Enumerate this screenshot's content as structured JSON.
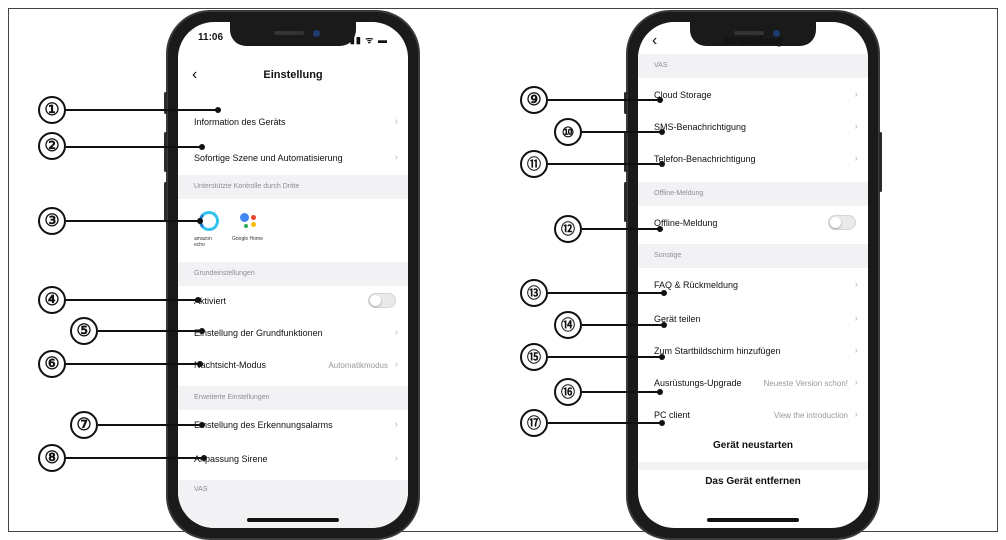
{
  "left_phone": {
    "time": "11:06",
    "status_icons": "▮▮ ᯤ ▬",
    "title": "Einstellung",
    "rows": {
      "info": "Information des Geräts",
      "szene": "Sofortige Szene und Automatisierung",
      "aktiviert": "Aktiviert",
      "grundfunktionen": "Einstellung der Grundfunktionen",
      "nachtsicht": "Nachtsicht-Modus",
      "nachtsicht_value": "Automatikmodus",
      "erkennung": "Einstellung des Erkennungsalarms",
      "sirene": "Anpassung Sirene"
    },
    "sections": {
      "dritte": "Unterstützte Kontrolle durch Dritte",
      "grund": "Grundeinstellungen",
      "erweitert": "Erweiterte Einstellungen",
      "vas": "VAS"
    },
    "logos": {
      "alexa": "amazon echo",
      "google": "Google Home"
    }
  },
  "right_phone": {
    "title": "Einstellung",
    "sections": {
      "vas": "VAS",
      "offline": "Offline-Meldung",
      "sonstige": "Sonstige"
    },
    "rows": {
      "cloud": "Cloud Storage",
      "sms": "SMS-Benachrichtigung",
      "telefon": "Telefon-Benachrichtigung",
      "offline": "Offline-Meldung",
      "faq": "FAQ & Rückmeldung",
      "teilen": "Gerät teilen",
      "startbild": "Zum Startbildschirm hinzufügen",
      "upgrade": "Ausrüstungs-Upgrade",
      "upgrade_value": "Neueste Version schon!",
      "pc": "PC client",
      "pc_value": "View the introduction"
    },
    "buttons": {
      "restart": "Gerät neustarten",
      "remove": "Das Gerät entfernen"
    }
  },
  "callouts": [
    "①",
    "②",
    "③",
    "④",
    "⑤",
    "⑥",
    "⑦",
    "⑧",
    "⑨",
    "⑩",
    "⑪",
    "⑫",
    "⑬",
    "⑭",
    "⑮",
    "⑯",
    "⑰"
  ],
  "chevron": "›",
  "icons": {
    "back": "‹",
    "chevron": "chevron-right-icon",
    "toggle": "toggle-switch"
  }
}
